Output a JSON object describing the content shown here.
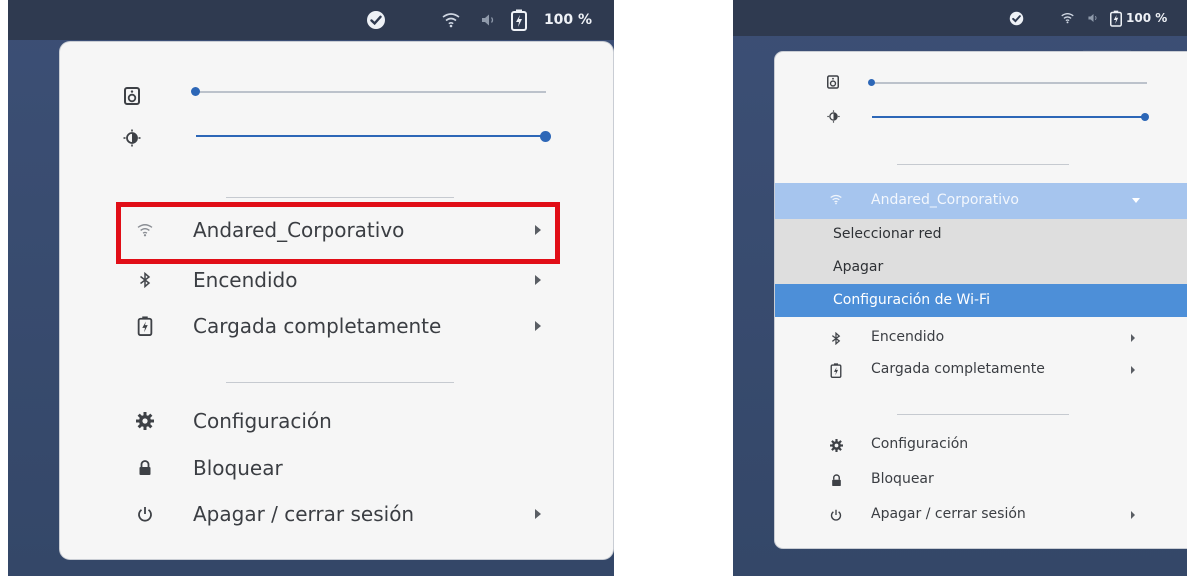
{
  "status_bar": {
    "battery_percent": "100 %"
  },
  "left_menu": {
    "sliders": [
      {
        "name": "volume",
        "icon": "speaker-icon",
        "value": 0.0
      },
      {
        "name": "brightness",
        "icon": "brightness-icon",
        "value": 1.0
      }
    ],
    "wifi": {
      "icon": "wifi-icon",
      "label": "Andared_Corporativo"
    },
    "bluetooth": {
      "icon": "bluetooth-icon",
      "label": "Encendido"
    },
    "battery": {
      "icon": "battery-icon",
      "label": "Cargada completamente"
    },
    "settings": {
      "icon": "gear-icon",
      "label": "Configuración"
    },
    "lock": {
      "icon": "lock-icon",
      "label": "Bloquear"
    },
    "power": {
      "icon": "power-icon",
      "label": "Apagar / cerrar sesión"
    }
  },
  "right_menu": {
    "status_bar": {
      "battery_percent": "100 %"
    },
    "sliders": [
      {
        "name": "volume",
        "icon": "speaker-icon",
        "value": 0.0
      },
      {
        "name": "brightness",
        "icon": "brightness-icon",
        "value": 1.0
      }
    ],
    "wifi": {
      "icon": "wifi-icon",
      "label": "Andared_Corporativo",
      "expanded": true
    },
    "wifi_submenu": [
      {
        "label": "Seleccionar red"
      },
      {
        "label": "Apagar"
      },
      {
        "label": "Configuración de Wi-Fi",
        "selected": true
      }
    ],
    "bluetooth": {
      "icon": "bluetooth-icon",
      "label": "Encendido"
    },
    "battery": {
      "icon": "battery-icon",
      "label": "Cargada completamente"
    },
    "settings": {
      "icon": "gear-icon",
      "label": "Configuración"
    },
    "lock": {
      "icon": "lock-icon",
      "label": "Bloquear"
    },
    "power": {
      "icon": "power-icon",
      "label": "Apagar / cerrar sesión"
    }
  },
  "colors": {
    "accent": "#2d67b7",
    "highlight_border": "#e10e17",
    "selected_item": "#4d8fd8",
    "wifi_header": "#a6c5ee",
    "submenu_bg": "#dedede",
    "topbar": "#2f3a50"
  }
}
